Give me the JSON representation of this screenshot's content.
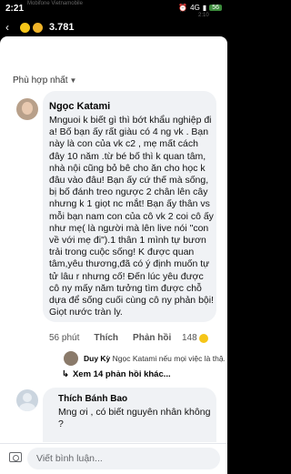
{
  "status_bar": {
    "time": "2:21",
    "signal": "4G",
    "battery": "56",
    "faded_left": "Mobifone Vietnamobile",
    "faded_right": "2:10"
  },
  "header": {
    "reaction_count": "3.781",
    "reaction_icons": [
      "haha-emoji-icon",
      "sad-emoji-icon"
    ]
  },
  "sort": {
    "label": "Phù hợp nhất"
  },
  "comment1": {
    "author": "Ngọc Katami",
    "body": "Mnguoi k biết gì thì bớt khẩu nghiệp đi a! Bố bạn ấy rất giàu có 4 ng vk . Bạn này là con của vk c2 , mẹ mất cách đây 10 năm .từ bé bố thì k quan tâm, nhà nội cũng bỏ bê cho ăn cho học k đâu vào đâu! Bạn ấy cứ thế mà sống, bị bố đánh treo ngược 2 chân lên cây nhưng k 1 giọt nc mắt! Bạn ấy thân vs mỗi bạn nam con của cô vk 2 coi cô ấy như mẹ( là người mà lên live nói \"con về với mẹ đi\").1 thân 1 mình tự bươn trải trong cuộc sống! K được quan tâm,yêu thương,đã có ý định muốn tự tử lâu r nhưng cố! Đến lúc yêu được cô ny mấy năm tưởng tìm được chỗ dựa để sống cuối cùng cô ny phản bội! Giọt nước tràn ly.",
    "time": "56 phút",
    "like_label": "Thích",
    "reply_label": "Phản hồi",
    "reaction_count": "148"
  },
  "reply_preview": {
    "author": "Duy Kỳ",
    "text": "Ngọc Katami nếu mọi việc là thậ..."
  },
  "more_replies": {
    "label": "Xem 14 phản hồi khác..."
  },
  "comment2": {
    "author": "Thích Bánh Bao",
    "body": "Mng ơi , có biết nguyên nhân không ?"
  },
  "composer": {
    "placeholder": "Viết bình luận..."
  }
}
